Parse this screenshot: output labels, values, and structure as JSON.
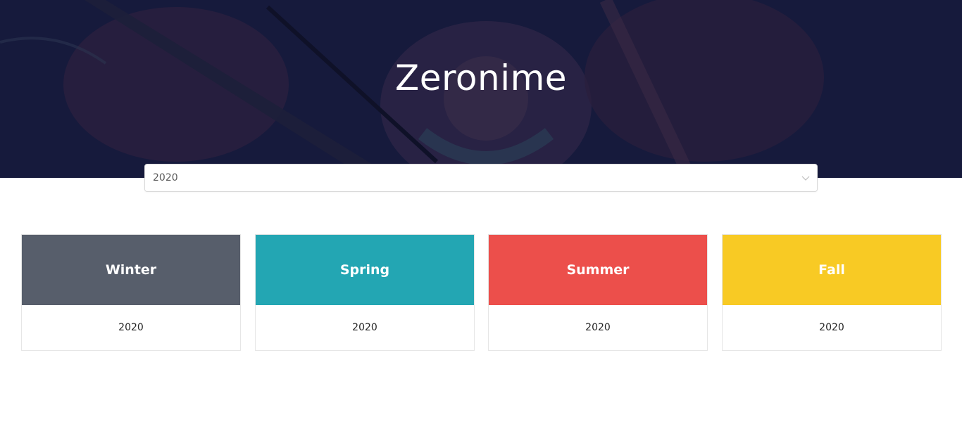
{
  "header": {
    "title": "Zeronime",
    "background_color": "#161a3c"
  },
  "year_select": {
    "value": "2020",
    "icon": "chevron-down-icon"
  },
  "seasons": [
    {
      "name": "Winter",
      "year": "2020",
      "color": "#575e6b"
    },
    {
      "name": "Spring",
      "year": "2020",
      "color": "#23a6b3"
    },
    {
      "name": "Summer",
      "year": "2020",
      "color": "#ec4f4b"
    },
    {
      "name": "Fall",
      "year": "2020",
      "color": "#f8ca24"
    }
  ]
}
